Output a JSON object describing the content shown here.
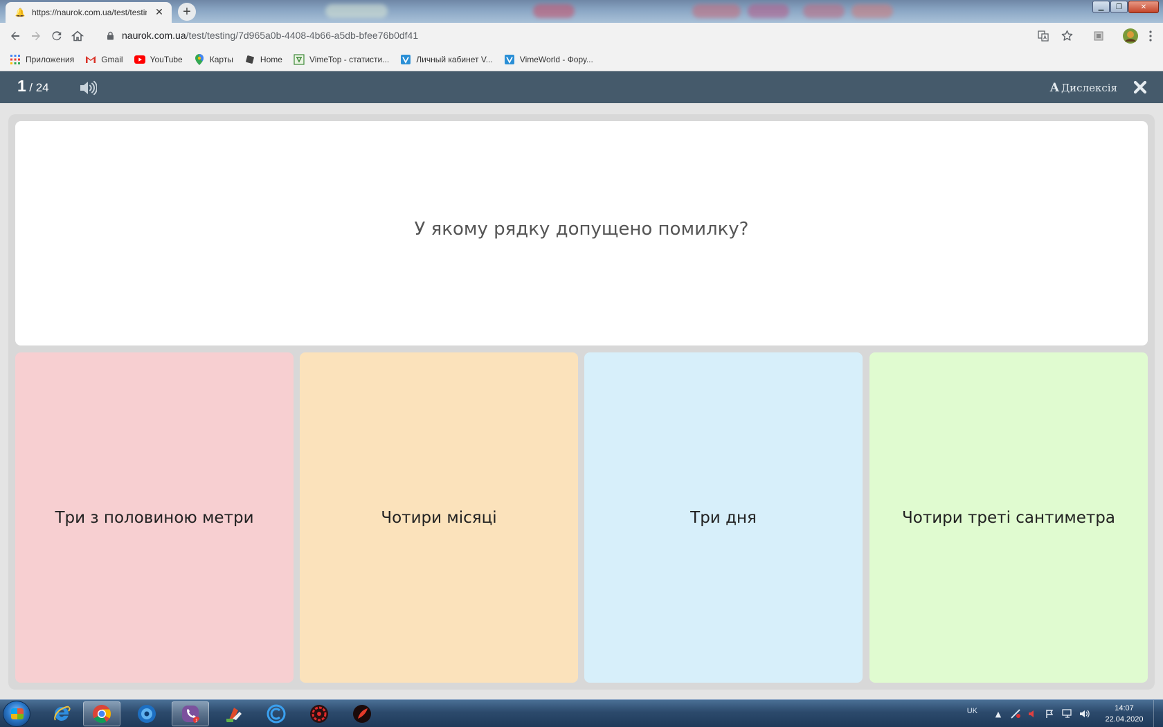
{
  "browser": {
    "tab_title": "https://naurok.com.ua/test/testing/7d965a0b-4408-4b66-a5db-bfee76b0df41",
    "url_host": "naurok.com.ua",
    "url_path": "/test/testing/7d965a0b-4408-4b66-a5db-bfee76b0df41",
    "bookmarks": [
      {
        "label": "Приложения",
        "icon": "apps-grid-icon"
      },
      {
        "label": "Gmail",
        "icon": "gmail-icon"
      },
      {
        "label": "YouTube",
        "icon": "youtube-icon"
      },
      {
        "label": "Карты",
        "icon": "maps-pin-icon"
      },
      {
        "label": "Home",
        "icon": "home-bookmark-icon"
      },
      {
        "label": "VimeTop - статисти...",
        "icon": "vimetop-icon"
      },
      {
        "label": "Личный кабинет V...",
        "icon": "vimeworld-icon"
      },
      {
        "label": "VimeWorld - Фору...",
        "icon": "vimeworld-icon"
      }
    ]
  },
  "quiz": {
    "current": "1",
    "total": "/ 24",
    "dyslexia_letter": "A",
    "dyslexia_label": "Дислексія",
    "question": "У якому рядку допущено помилку?",
    "answers": [
      {
        "text": "Три з половиною метри",
        "color": "#f7cfd1"
      },
      {
        "text": "Чотири місяці",
        "color": "#fbe2bb"
      },
      {
        "text": "Три дня",
        "color": "#d7effa"
      },
      {
        "text": "Чотири треті сантиметра",
        "color": "#e0fbd0"
      }
    ],
    "header_color": "#455a6b"
  },
  "taskbar": {
    "language": "UK",
    "time": "14:07",
    "date": "22.04.2020"
  }
}
